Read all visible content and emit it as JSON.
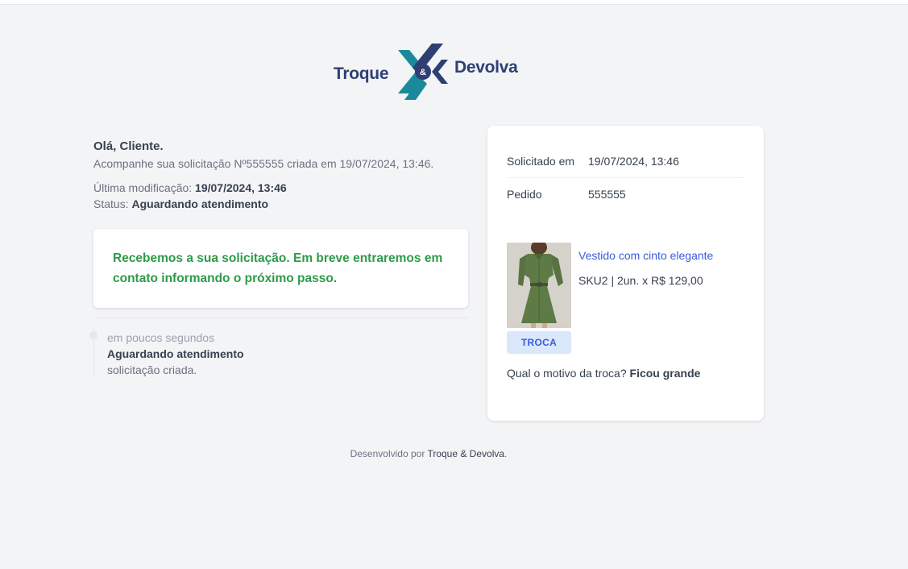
{
  "logo": {
    "left_text": "Troque",
    "center_text": "&",
    "right_text": "Devolva",
    "colors": {
      "teal": "#1a8a9a",
      "navy": "#2f3f73"
    }
  },
  "greeting": "Olá, Cliente.",
  "subline": "Acompanhe sua solicitação Nº555555 criada em 19/07/2024, 13:46.",
  "last_modified": {
    "label": "Última modificação:",
    "value": "19/07/2024, 13:46"
  },
  "status": {
    "label": "Status:",
    "value": "Aguardando atendimento"
  },
  "message": "Recebemos a sua solicitação. Em breve entraremos em contato informando o próximo passo.",
  "timeline": [
    {
      "time": "em poucos segundos",
      "title": "Aguardando atendimento",
      "description": "solicitação criada."
    }
  ],
  "order_card": {
    "requested_label": "Solicitado em",
    "requested_value": "19/07/2024, 13:46",
    "order_label": "Pedido",
    "order_value": "555555",
    "product": {
      "name": "Vestido com cinto elegante",
      "sku_line": "SKU2 | 2un. x R$ 129,00",
      "badge": "TROCA",
      "image_icon": "green-dress-photo"
    },
    "reason_question": "Qual o motivo da troca?",
    "reason_answer": "Ficou grande"
  },
  "footer": {
    "prefix": "Desenvolvido por ",
    "brand": "Troque & Devolva",
    "suffix": "."
  },
  "colors": {
    "background": "#f3f4f6",
    "success_text": "#2e9a48",
    "link": "#3b5bdb",
    "badge_bg": "#dbe7fb"
  }
}
